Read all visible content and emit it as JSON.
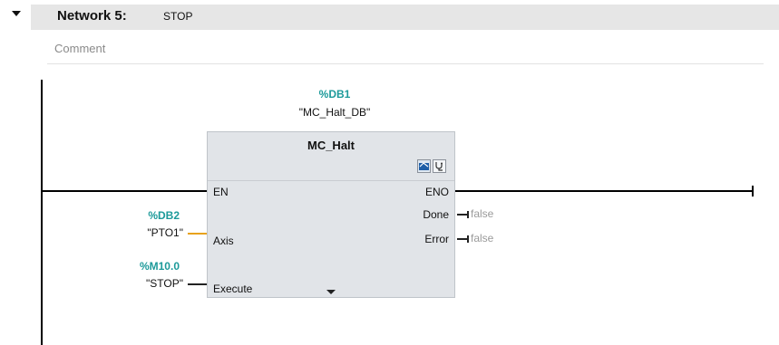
{
  "network": {
    "title": "Network 5:",
    "name": "STOP",
    "comment_placeholder": "Comment"
  },
  "instance": {
    "address": "%DB1",
    "name": "\"MC_Halt_DB\""
  },
  "block": {
    "title": "MC_Halt",
    "icons": [
      "view-icon",
      "diagnostics-icon"
    ],
    "inputs": {
      "en": "EN",
      "axis": "Axis",
      "execute": "Execute"
    },
    "outputs": {
      "eno": "ENO",
      "done": "Done",
      "error": "Error"
    }
  },
  "params": {
    "axis": {
      "address": "%DB2",
      "name": "\"PTO1\""
    },
    "execute": {
      "address": "%M10.0",
      "name": "\"STOP\""
    }
  },
  "outputs_values": {
    "done": "false",
    "error": "false"
  },
  "colors": {
    "accent": "#1d9a9a",
    "axis_wire": "#e8a21c",
    "block_bg": "#e1e4e8"
  }
}
